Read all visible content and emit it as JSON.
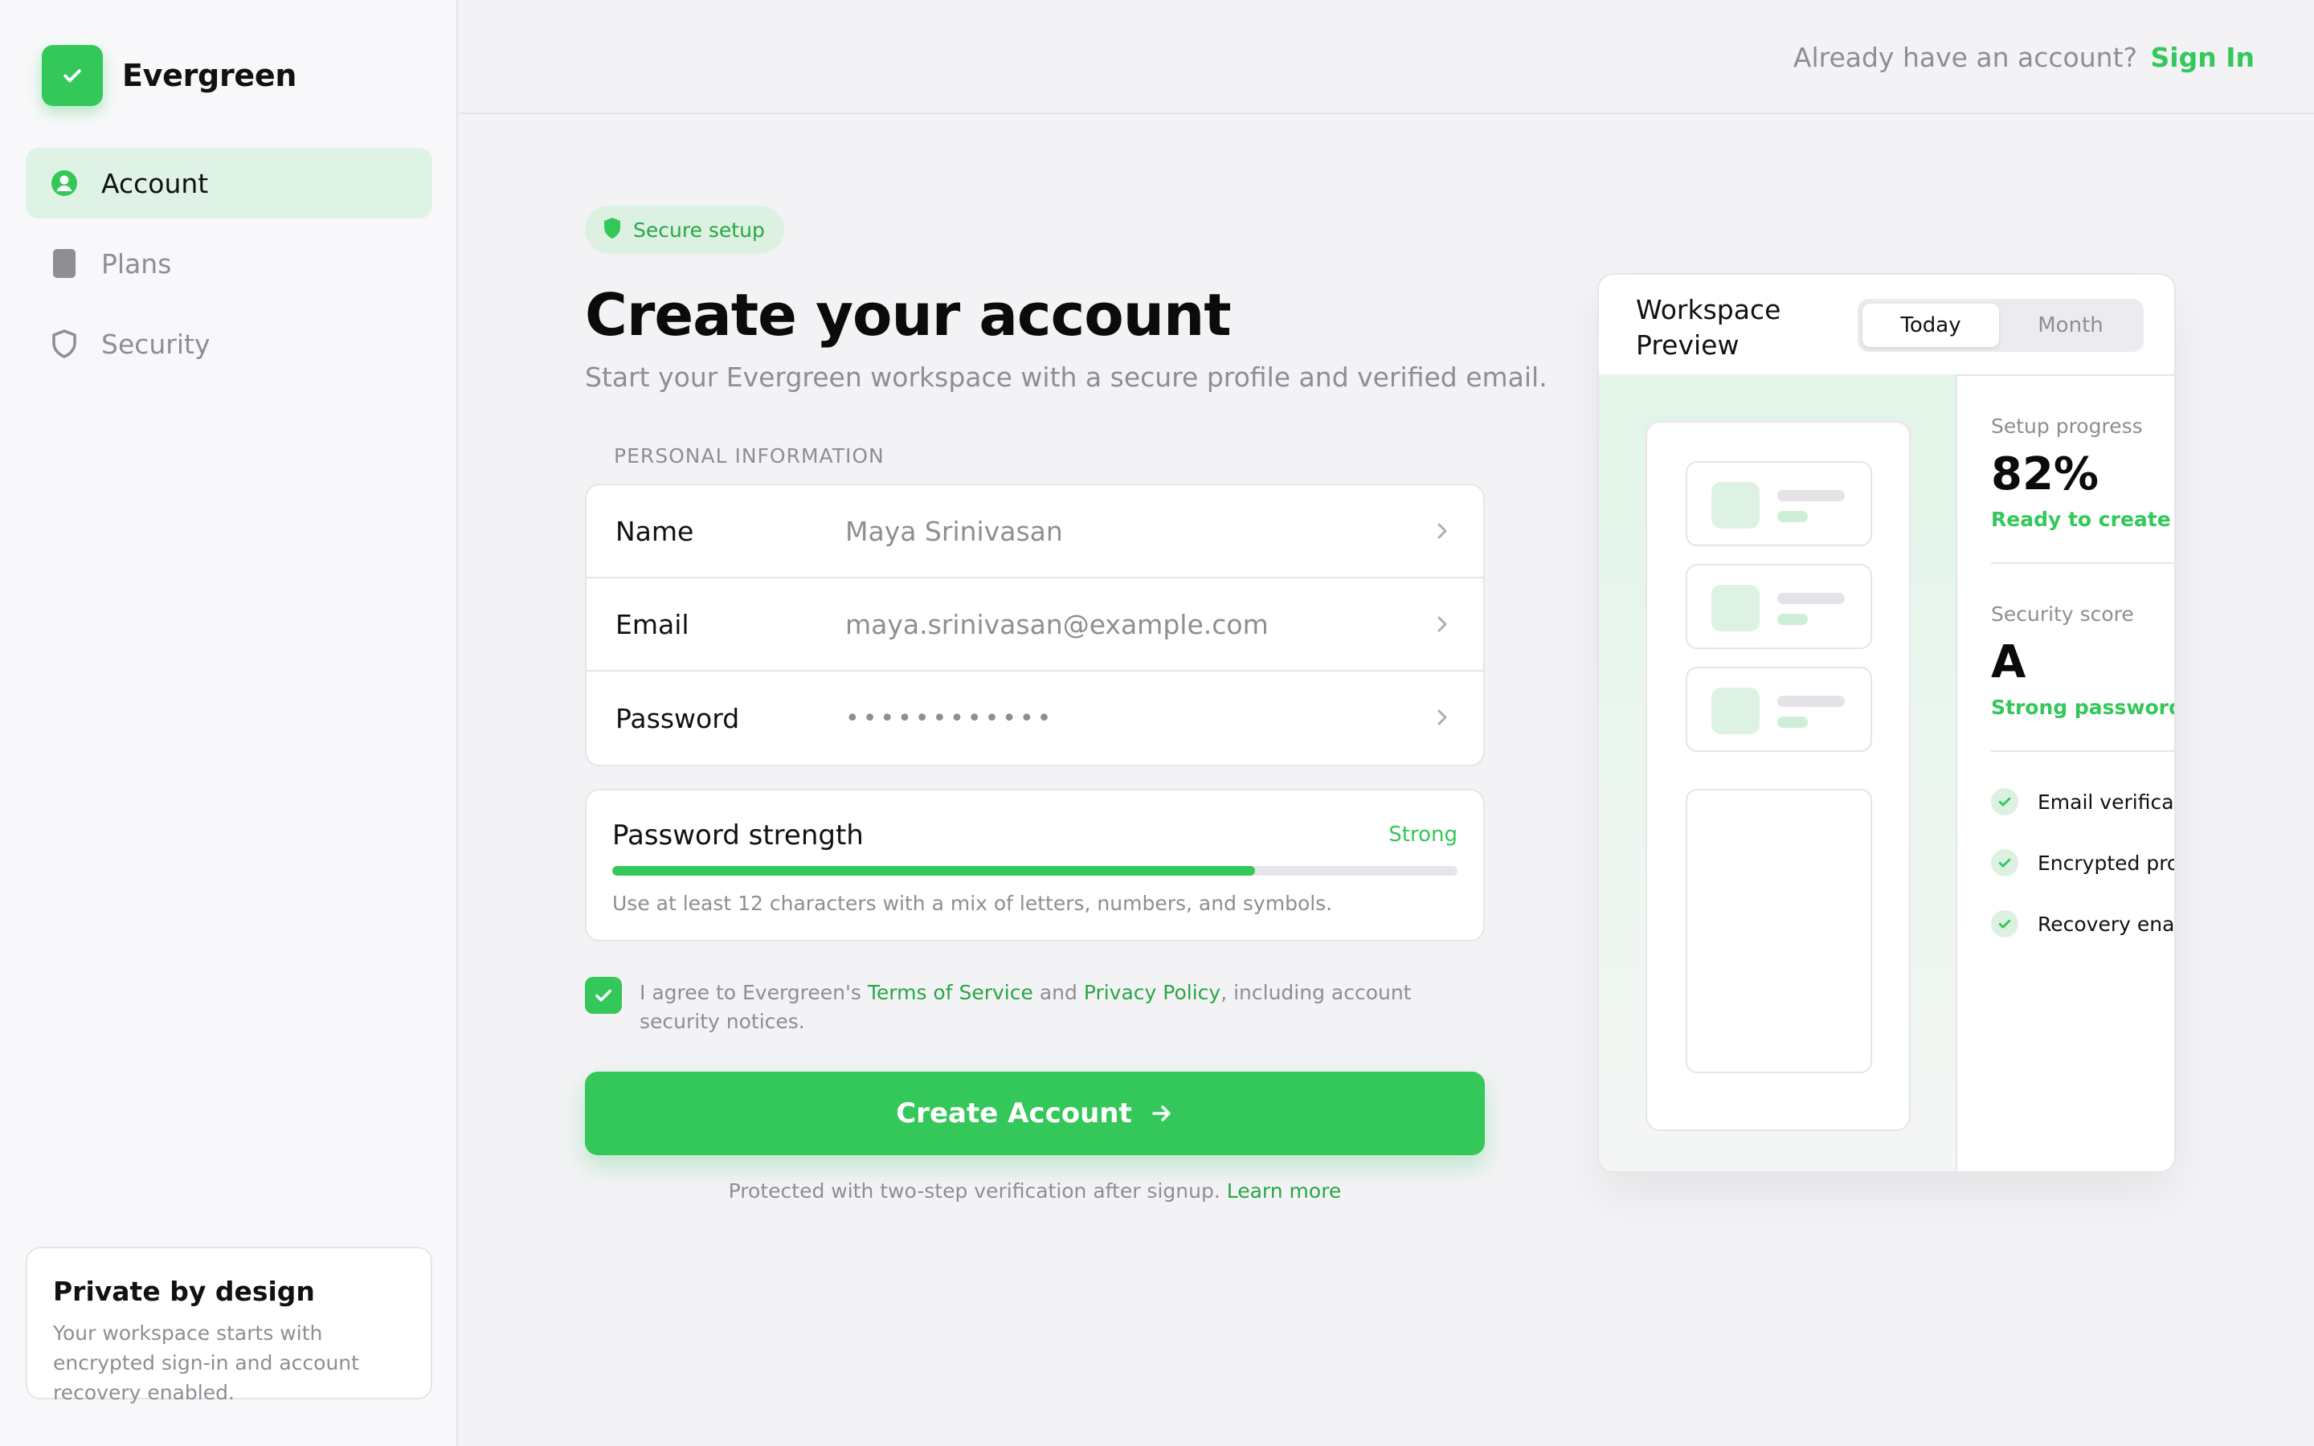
{
  "brand": {
    "name": "Evergreen",
    "color": "#34c759"
  },
  "sidebar": {
    "items": [
      {
        "label": "Account",
        "icon": "person-circle-icon",
        "active": true
      },
      {
        "label": "Plans",
        "icon": "document-icon",
        "active": false
      },
      {
        "label": "Security",
        "icon": "shield-icon",
        "active": false
      }
    ],
    "privacy": {
      "title": "Private by design",
      "text": "Your workspace starts with encrypted sign-in and account recovery enabled."
    }
  },
  "topbar": {
    "prompt": "Already have an account?",
    "signin_label": "Sign In"
  },
  "form": {
    "badge": "Secure setup",
    "title": "Create your account",
    "subtitle": "Start your Evergreen workspace with a secure profile and verified email.",
    "section_label": "PERSONAL INFORMATION",
    "fields": [
      {
        "label": "Name",
        "value": "Maya Srinivasan"
      },
      {
        "label": "Email",
        "value": "maya.srinivasan@example.com"
      },
      {
        "label": "Password",
        "value": "••••••••••••"
      }
    ],
    "strength": {
      "title": "Password strength",
      "status": "Strong",
      "level": 0.76,
      "hint": "Use at least 12 characters with a mix of letters, numbers, and symbols."
    },
    "agree": {
      "checked": true,
      "prefix": "I agree to Evergreen's ",
      "terms": "Terms of Service",
      "and": " and ",
      "privacy": "Privacy Policy",
      "suffix": ", including account security notices."
    },
    "submit_label": "Create Account",
    "footer": {
      "text": "Protected with two-step verification after signup.",
      "link": "Learn more"
    }
  },
  "preview": {
    "title": "Workspace Preview",
    "tabs": [
      {
        "label": "Today",
        "active": true
      },
      {
        "label": "Month",
        "active": false
      }
    ],
    "setup": {
      "label": "Setup progress",
      "value": "82%",
      "sub": "Ready to create"
    },
    "security": {
      "label": "Security score",
      "value": "A",
      "sub": "Strong password"
    },
    "checks": [
      "Email verification",
      "Encrypted profile",
      "Recovery enabled"
    ]
  }
}
